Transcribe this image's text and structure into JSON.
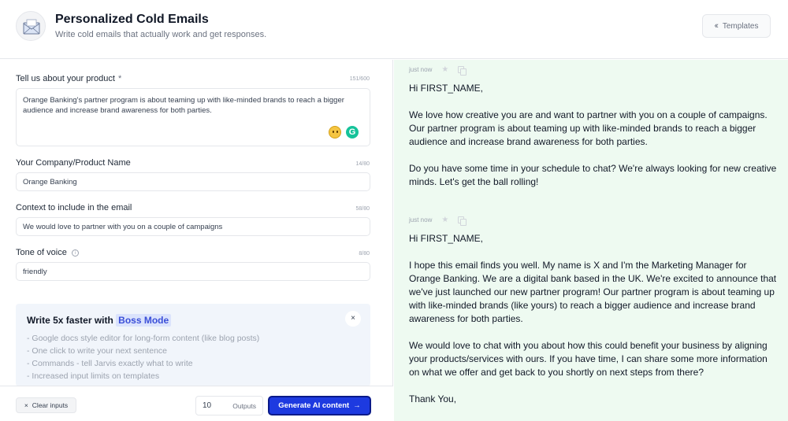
{
  "header": {
    "title": "Personalized Cold Emails",
    "subtitle": "Write cold emails that actually work and get responses.",
    "templates_label": "Templates",
    "templates_icon": "chevrons-left-icon"
  },
  "form": {
    "product": {
      "label": "Tell us about your product",
      "required_mark": "*",
      "counter": "151/600",
      "value": "Orange Banking's partner program is about teaming up with like-minded brands to reach a bigger audience and increase brand awareness for both parties."
    },
    "company": {
      "label": "Your Company/Product Name",
      "counter": "14/80",
      "value": "Orange Banking"
    },
    "context": {
      "label": "Context to include in the email",
      "counter": "58/80",
      "value": "We would love to partner with you on a couple of campaigns"
    },
    "tone": {
      "label": "Tone of voice",
      "counter": "8/80",
      "value": "friendly",
      "info_icon": "i"
    }
  },
  "promo": {
    "title_prefix": "Write 5x faster with",
    "title_highlight": "Boss Mode",
    "close": "×",
    "items": [
      "- Google docs style editor for long-form content (like blog posts)",
      "- One click to write your next sentence",
      "- Commands - tell Jarvis exactly what to write",
      "- Increased input limits on templates"
    ]
  },
  "actions": {
    "clear_label": "Clear inputs",
    "clear_icon": "×",
    "outputs_value": "10",
    "outputs_label": "Outputs",
    "generate_label": "Generate AI content",
    "generate_arrow": "→"
  },
  "results": [
    {
      "time": "just now",
      "paragraphs": [
        "Hi FIRST_NAME,",
        "We love how creative you are and want to partner with you on a couple of campaigns. Our partner program is about teaming up with like-minded brands to reach a bigger audience and increase brand awareness for both parties.",
        "Do you have some time in your schedule to chat? We're always looking for new creative minds. Let's get the ball rolling!"
      ]
    },
    {
      "time": "just now",
      "paragraphs": [
        "Hi FIRST_NAME,",
        "I hope this email finds you well. My name is X and I'm the Marketing Manager for Orange Banking. We are a digital bank based in the UK. We're excited to announce that we've just launched our new partner program! Our partner program is about teaming up with like-minded brands (like yours) to reach a bigger audience and increase brand awareness for both parties.",
        "We would love to chat with you about how this could benefit your business by aligning your products/services with ours. If you have time, I can share some more information on what we offer and get back to you shortly on next steps from there?",
        "Thank You,"
      ]
    }
  ]
}
